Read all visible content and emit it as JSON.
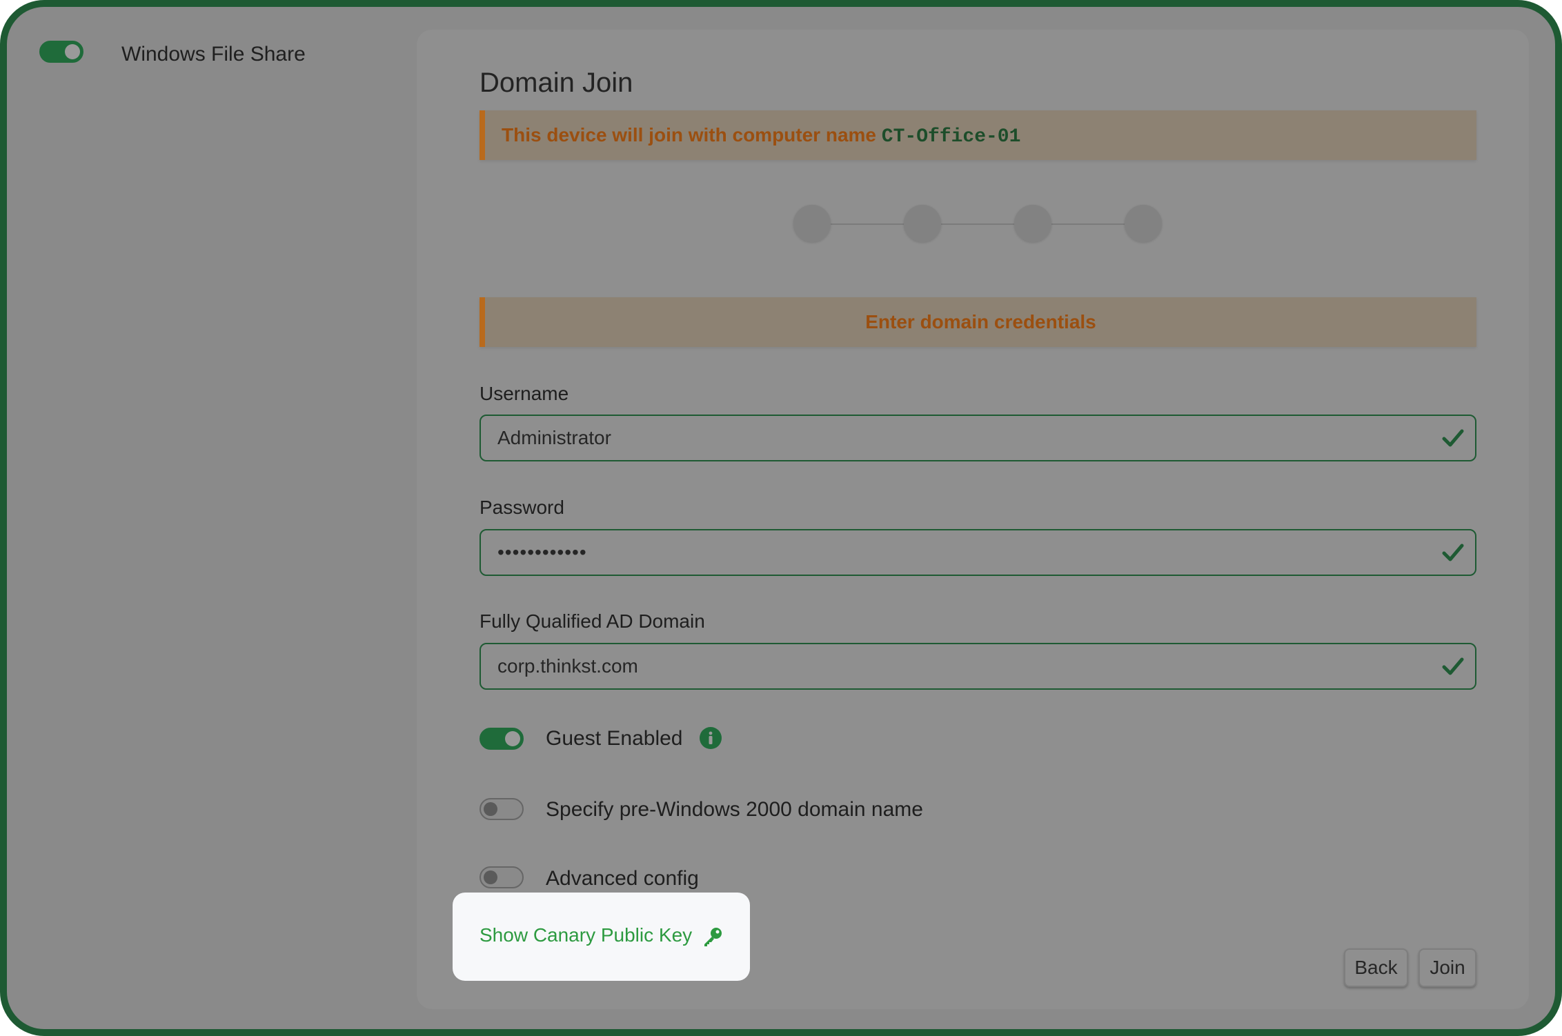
{
  "sidebar": {
    "service_label": "Windows File Share",
    "service_enabled": true
  },
  "page": {
    "title": "Domain Join"
  },
  "join_notice": {
    "prefix": "This device will join with computer name ",
    "computer_name": "CT-Office-01"
  },
  "wizard": {
    "steps": 4
  },
  "credentials_banner": "Enter domain credentials",
  "fields": {
    "username": {
      "label": "Username",
      "value": "Administrator",
      "valid": true
    },
    "password": {
      "label": "Password",
      "value": "••••••••••••",
      "valid": true
    },
    "domain": {
      "label": "Fully Qualified AD Domain",
      "value": "corp.thinkst.com",
      "valid": true
    }
  },
  "options": {
    "guest": {
      "label": "Guest Enabled",
      "enabled": true,
      "info_icon": "info-icon"
    },
    "pre_win2000": {
      "label": "Specify pre-Windows 2000 domain name",
      "enabled": false
    },
    "advanced": {
      "label": "Advanced config",
      "enabled": false
    }
  },
  "public_key_link": {
    "label": "Show Canary Public Key",
    "icon": "key-icon"
  },
  "buttons": {
    "back": "Back",
    "join": "Join"
  },
  "colors": {
    "accent": "#1f6b3a",
    "warning": "#b96a1c",
    "link": "#2d9a40"
  }
}
